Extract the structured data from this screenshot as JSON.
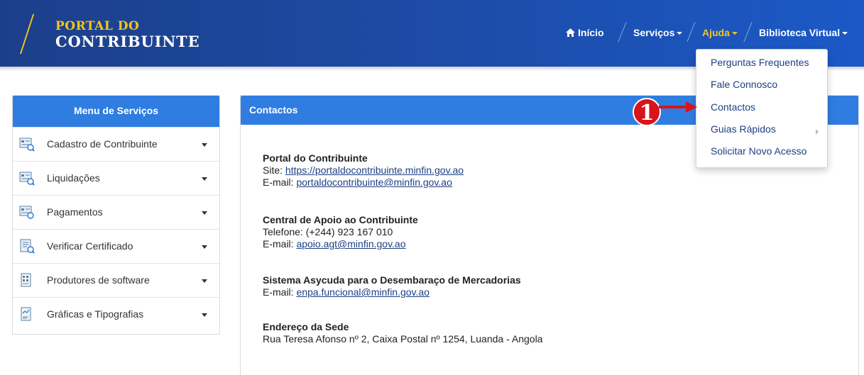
{
  "header": {
    "logo_line1": "PORTAL DO",
    "logo_line2": "CONTRIBUINTE",
    "nav": {
      "home": "Início",
      "servicos": "Serviços",
      "ajuda": "Ajuda",
      "biblioteca": "Biblioteca Virtual"
    }
  },
  "dropdown": {
    "items": [
      "Perguntas Frequentes",
      "Fale Connosco",
      "Contactos",
      "Guias Rápidos",
      "Solicitar Novo Acesso"
    ]
  },
  "annotation": {
    "number": "1"
  },
  "side_menu": {
    "title": "Menu de Serviços",
    "items": [
      {
        "label": "Cadastro de Contribuinte",
        "icon": "register-icon"
      },
      {
        "label": "Liquidações",
        "icon": "liquidation-icon"
      },
      {
        "label": "Pagamentos",
        "icon": "payment-icon"
      },
      {
        "label": "Verificar Certificado",
        "icon": "certificate-icon"
      },
      {
        "label": "Produtores de software",
        "icon": "software-icon"
      },
      {
        "label": "Gráficas e Tipografias",
        "icon": "print-icon"
      }
    ]
  },
  "panel": {
    "title": "Contactos",
    "blocks": [
      {
        "title": "Portal do Contribuinte",
        "line1_prefix": "Site:",
        "line1_link": "https://portaldocontribuinte.minfin.gov.ao",
        "line2_prefix": "E-mail:",
        "line2_link": "portaldocontribuinte@minfin.gov.ao"
      },
      {
        "title": "Central de Apoio ao Contribuinte",
        "line1_text": "Telefone: (+244) 923 167 010",
        "line2_prefix": "E-mail:",
        "line2_link": "apoio.agt@minfin.gov.ao"
      },
      {
        "title": "Sistema Asycuda para o Desembaraço de Mercadorias",
        "line2_prefix": "E-mail:",
        "line2_link": "enpa.funcional@minfin.gov.ao"
      },
      {
        "title": "Endereço da Sede",
        "line1_text": "Rua Teresa Afonso nº 2, Caixa Postal nº 1254, Luanda - Angola"
      }
    ]
  },
  "colors": {
    "header_dark": "#1c3f8a",
    "accent_blue": "#2f7de1",
    "gold": "#f5c518",
    "link": "#1d3f82",
    "annotation_red": "#d7141a"
  }
}
